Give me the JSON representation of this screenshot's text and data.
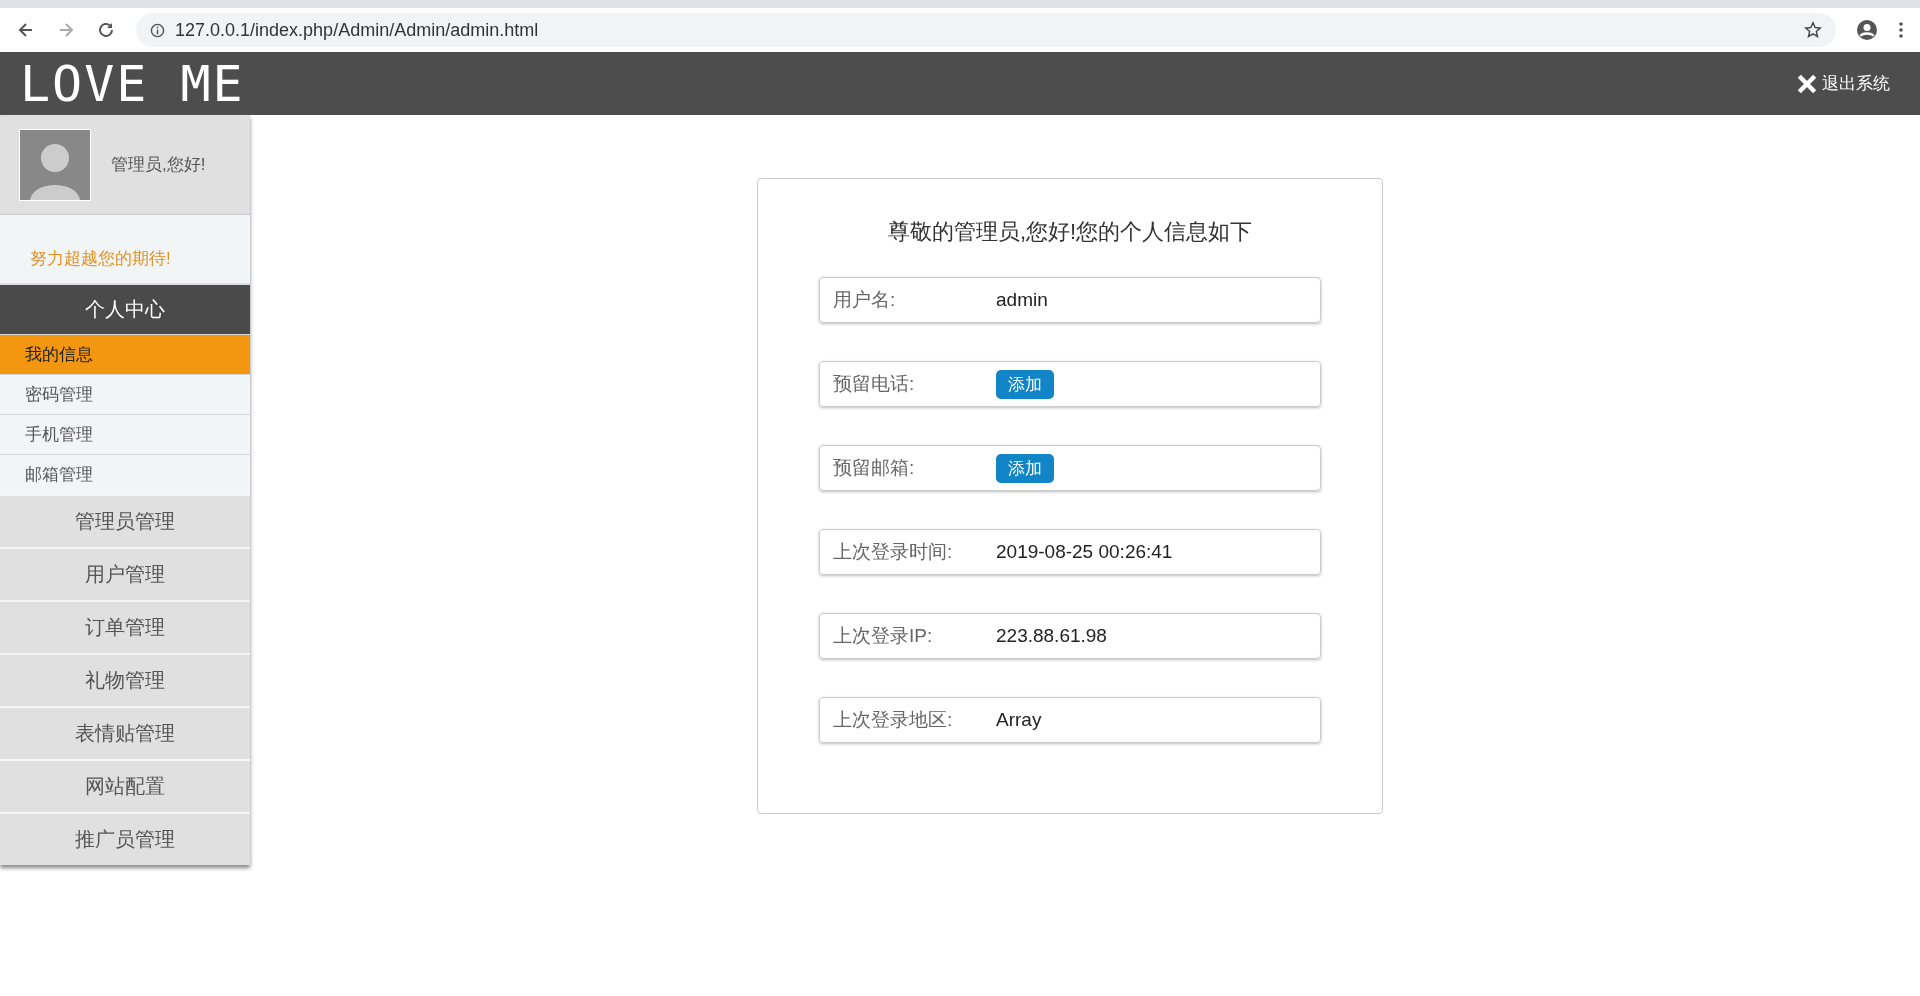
{
  "browser": {
    "url": "127.0.0.1/index.php/Admin/Admin/admin.html"
  },
  "header": {
    "logo": "LOVE ME",
    "logout": "退出系统"
  },
  "sidebar": {
    "greeting": "管理员,您好!",
    "motto": "努力超越您的期待!",
    "section": "个人中心",
    "sub_items": [
      {
        "label": "我的信息",
        "selected": true
      },
      {
        "label": "密码管理",
        "selected": false
      },
      {
        "label": "手机管理",
        "selected": false
      },
      {
        "label": "邮箱管理",
        "selected": false
      }
    ],
    "menu": [
      "管理员管理",
      "用户管理",
      "订单管理",
      "礼物管理",
      "表情贴管理",
      "网站配置",
      "推广员管理"
    ]
  },
  "card": {
    "title": "尊敬的管理员,您好!您的个人信息如下",
    "fields": [
      {
        "label": "用户名:",
        "kind": "text",
        "value": "admin"
      },
      {
        "label": "预留电话:",
        "kind": "action",
        "value": "添加"
      },
      {
        "label": "预留邮箱:",
        "kind": "action",
        "value": "添加"
      },
      {
        "label": "上次登录时间:",
        "kind": "text",
        "value": "2019-08-25 00:26:41"
      },
      {
        "label": "上次登录IP:",
        "kind": "text",
        "value": "223.88.61.98"
      },
      {
        "label": "上次登录地区:",
        "kind": "text",
        "value": "Array"
      }
    ]
  }
}
